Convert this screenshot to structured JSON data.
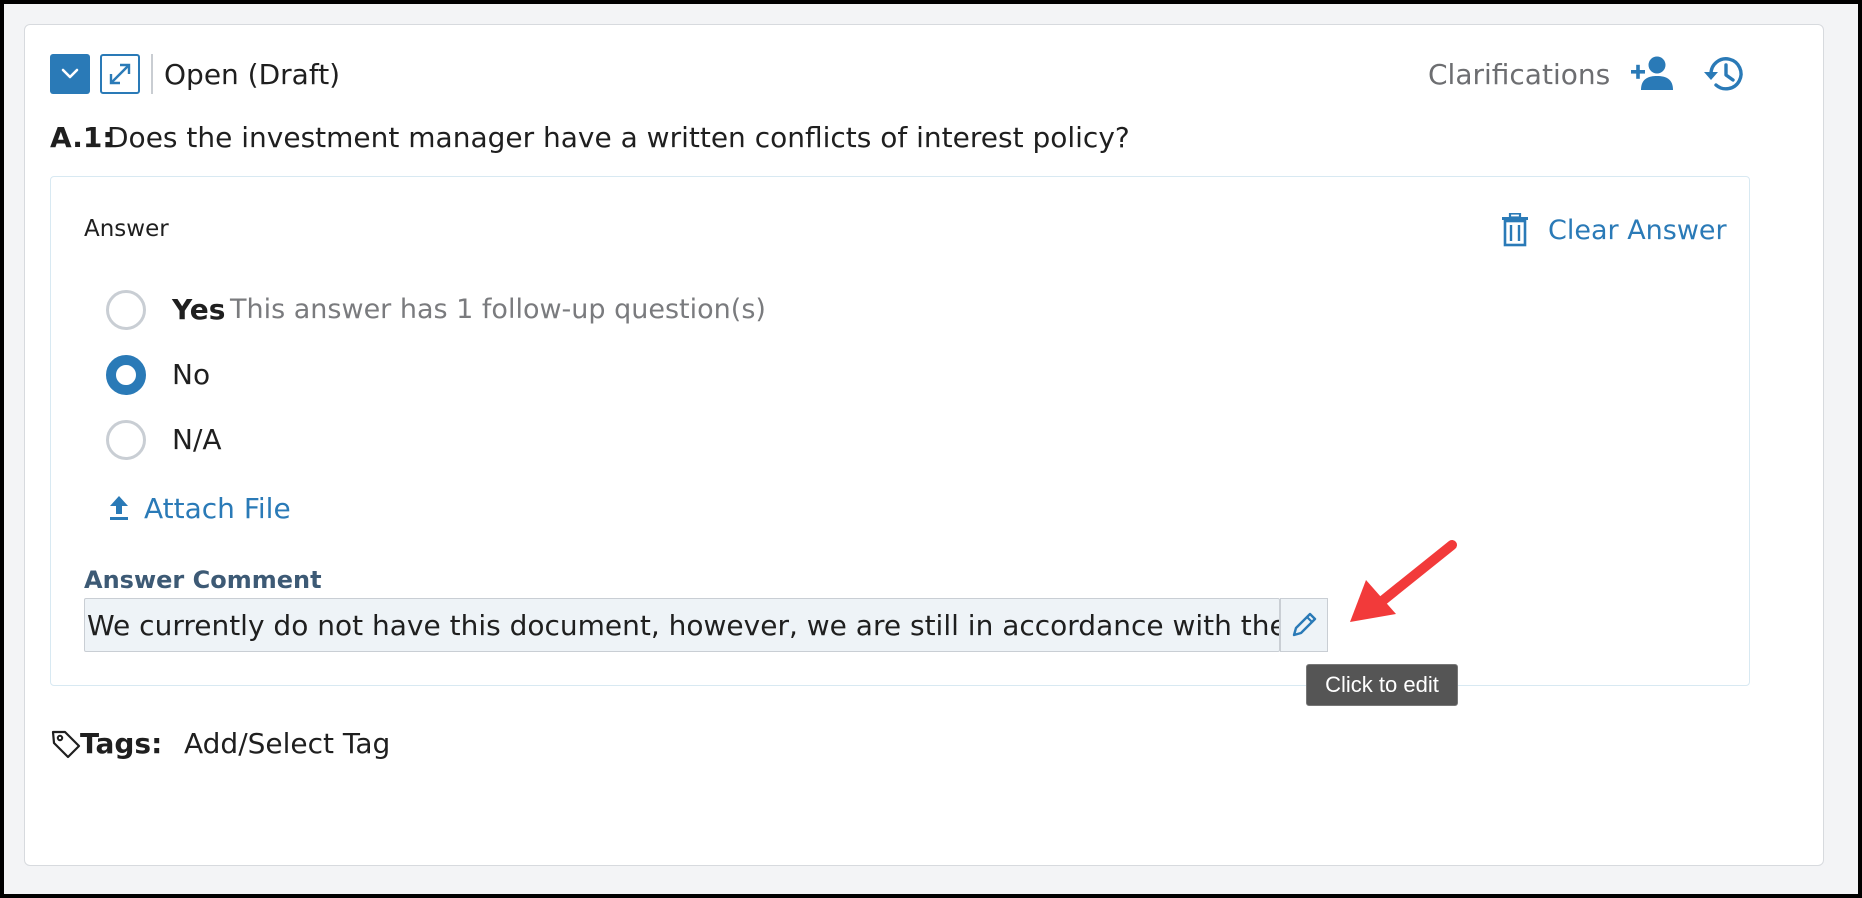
{
  "header": {
    "status": "Open (Draft)",
    "clarifications_label": "Clarifications",
    "collapse_icon": "chevron-down-icon",
    "expand_icon": "expand-arrows-icon",
    "add_user_icon": "add-user-icon",
    "history_icon": "history-icon"
  },
  "question": {
    "number": "A.1:",
    "text": "Does the investment manager have a written conflicts of interest policy?"
  },
  "answer": {
    "label": "Answer",
    "clear_label": "Clear Answer",
    "options": [
      {
        "label": "Yes",
        "hint": "This answer has 1 follow-up question(s)",
        "checked": false
      },
      {
        "label": "No",
        "hint": "",
        "checked": true
      },
      {
        "label": "N/A",
        "hint": "",
        "checked": false
      }
    ],
    "attach_label": "Attach File",
    "comment_label": "Answer Comment",
    "comment_value": "We currently do not have this document, however, we are still in accordance with the policy.",
    "edit_tooltip": "Click to edit"
  },
  "tags": {
    "label": "Tags:",
    "add_label": "Add/Select Tag"
  },
  "colors": {
    "accent": "#2a7ab7",
    "annotation_arrow": "#f23a3a",
    "tooltip_bg": "#555555"
  }
}
